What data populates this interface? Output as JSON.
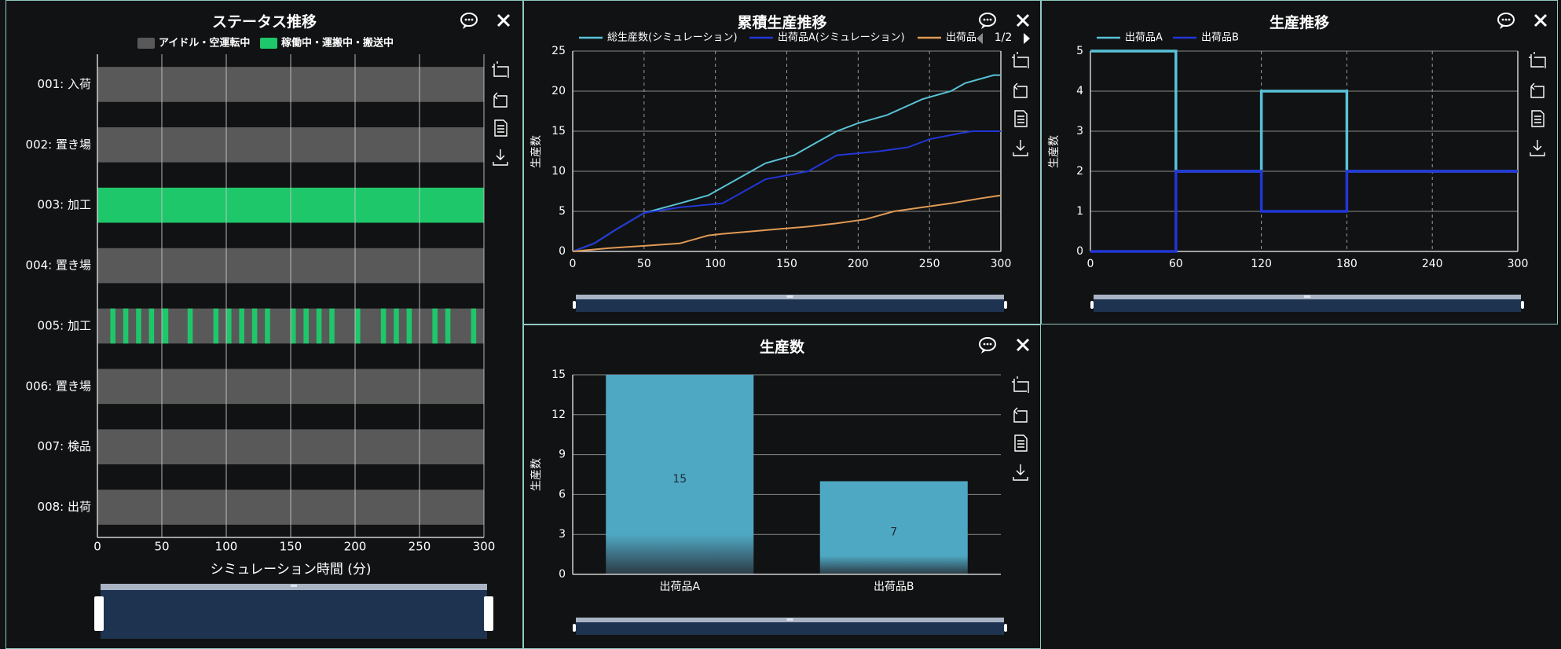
{
  "colors": {
    "background": "#111213",
    "panel_border": "#8fc9c2",
    "idle": "#595959",
    "working": "#1ec76a",
    "total_line": "#58c2d8",
    "product_a_line": "#2236d6",
    "product_b_line": "#e09a55",
    "bar": "#4fa8c3",
    "slider_fill": "#1e3350",
    "slider_bar": "#a9b3c4"
  },
  "icons": {
    "comment": "comment-icon",
    "close": "close-icon",
    "tools": [
      "zoom-area-icon",
      "zoom-reset-icon",
      "data-view-icon",
      "save-image-icon"
    ]
  },
  "pager": {
    "text": "1/2"
  },
  "panels": {
    "status": {
      "title": "ステータス推移"
    },
    "cumulative": {
      "title": "累積生産推移"
    },
    "transition": {
      "title": "生産推移"
    },
    "count": {
      "title": "生産数"
    }
  },
  "chart_data": [
    {
      "id": "status",
      "type": "bar",
      "subtype": "gantt",
      "title": "ステータス推移",
      "xlabel": "シミュレーション時間 (分)",
      "ylabel": "",
      "xlim": [
        0,
        300
      ],
      "xticks": [
        0,
        50,
        100,
        150,
        200,
        250,
        300
      ],
      "grid": true,
      "legend": [
        "アイドル・空運転中",
        "稼働中・運搬中・搬送中"
      ],
      "legend_position": "top",
      "rows": [
        {
          "label": "001: 入荷",
          "working": []
        },
        {
          "label": "002: 置き場",
          "working": []
        },
        {
          "label": "003: 加工",
          "working": [
            [
              0,
              300
            ]
          ]
        },
        {
          "label": "004: 置き場",
          "working": []
        },
        {
          "label": "005: 加工",
          "working": [
            [
              10,
              14
            ],
            [
              20,
              24
            ],
            [
              30,
              34
            ],
            [
              40,
              44
            ],
            [
              50,
              55
            ],
            [
              70,
              74
            ],
            [
              90,
              94
            ],
            [
              100,
              104
            ],
            [
              110,
              114
            ],
            [
              120,
              124
            ],
            [
              130,
              134
            ],
            [
              150,
              154
            ],
            [
              160,
              164
            ],
            [
              170,
              174
            ],
            [
              180,
              184
            ],
            [
              200,
              204
            ],
            [
              220,
              224
            ],
            [
              230,
              234
            ],
            [
              240,
              244
            ],
            [
              260,
              264
            ],
            [
              270,
              274
            ],
            [
              290,
              294
            ]
          ]
        },
        {
          "label": "006: 置き場",
          "working": []
        },
        {
          "label": "007: 検品",
          "working": []
        },
        {
          "label": "008: 出荷",
          "working": []
        }
      ]
    },
    {
      "id": "cumulative",
      "type": "line",
      "title": "累積生産推移",
      "xlabel": "",
      "ylabel": "生産数",
      "xlim": [
        0,
        300
      ],
      "ylim": [
        0,
        25
      ],
      "xticks": [
        0,
        50,
        100,
        150,
        200,
        250,
        300
      ],
      "yticks": [
        0,
        5,
        10,
        15,
        20,
        25
      ],
      "grid": true,
      "legend_position": "top",
      "series": [
        {
          "name": "総生産数(シミュレーション)",
          "x": [
            0,
            15,
            30,
            50,
            75,
            95,
            115,
            135,
            155,
            170,
            185,
            200,
            220,
            245,
            265,
            275,
            295,
            300
          ],
          "y": [
            0,
            1,
            2.7,
            4.8,
            6,
            7,
            9,
            11,
            12,
            13.5,
            15,
            16,
            17,
            19,
            20,
            21,
            22,
            22
          ]
        },
        {
          "name": "出荷品A(シミュレーション)",
          "x": [
            0,
            15,
            30,
            50,
            75,
            105,
            135,
            165,
            185,
            215,
            235,
            250,
            270,
            280,
            300
          ],
          "y": [
            0,
            1,
            2.7,
            4.8,
            5.5,
            6,
            9,
            10,
            12,
            12.5,
            13,
            14,
            14.7,
            15,
            15
          ]
        },
        {
          "name": "出荷品",
          "x": [
            0,
            25,
            50,
            75,
            95,
            105,
            125,
            145,
            165,
            185,
            205,
            225,
            245,
            265,
            285,
            300
          ],
          "y": [
            0,
            0.4,
            0.7,
            1,
            2,
            2.2,
            2.5,
            2.8,
            3.1,
            3.5,
            4,
            5,
            5.5,
            6,
            6.6,
            7
          ]
        }
      ]
    },
    {
      "id": "transition",
      "type": "line",
      "subtype": "step",
      "title": "生産推移",
      "xlabel": "",
      "ylabel": "生産数",
      "xlim": [
        0,
        300
      ],
      "ylim": [
        0,
        5
      ],
      "xticks": [
        0,
        60,
        120,
        180,
        240,
        300
      ],
      "yticks": [
        0,
        1,
        2,
        3,
        4,
        5
      ],
      "grid": true,
      "legend_position": "top",
      "series": [
        {
          "name": "出荷品A",
          "x": [
            0,
            60,
            120,
            180,
            240,
            300
          ],
          "y": [
            5,
            2,
            4,
            2,
            2,
            2
          ]
        },
        {
          "name": "出荷品B",
          "x": [
            0,
            60,
            120,
            180,
            240,
            300
          ],
          "y": [
            0,
            2,
            1,
            2,
            2,
            2
          ]
        }
      ]
    },
    {
      "id": "count",
      "type": "bar",
      "title": "生産数",
      "xlabel": "",
      "ylabel": "生産数",
      "ylim": [
        0,
        15
      ],
      "yticks": [
        0,
        3,
        6,
        9,
        12,
        15
      ],
      "grid": true,
      "categories": [
        "出荷品A",
        "出荷品B"
      ],
      "values": [
        15,
        7
      ]
    }
  ]
}
